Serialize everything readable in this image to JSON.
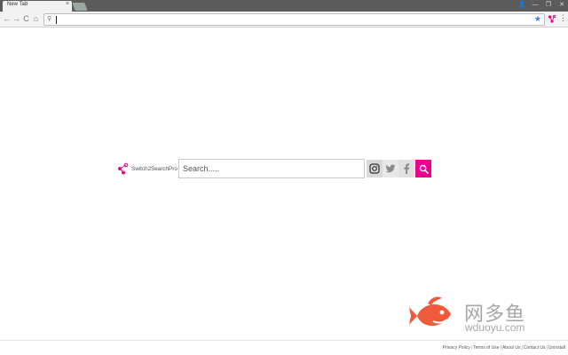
{
  "browser": {
    "tab_title": "New Tab",
    "tab_close": "×",
    "omnibox_value": "",
    "window_controls": [
      "👤",
      "—",
      "❐",
      "✕"
    ]
  },
  "nav": {
    "back": "←",
    "forward": "→",
    "reload": "C",
    "home": "⌂",
    "menu": "⋮",
    "bookmark_star": "★",
    "search_glyph": "⚲"
  },
  "brand": {
    "name": "Switch2SearchPro",
    "accent": "#ec008c"
  },
  "search": {
    "placeholder": "Search....."
  },
  "social": [
    "instagram-icon",
    "twitter-icon",
    "facebook-icon"
  ],
  "footer": {
    "links": [
      "Privacy Policy",
      "Terms of Use",
      "About Us",
      "Contact Us",
      "Uninstall"
    ]
  },
  "watermark": {
    "cn": "网多鱼",
    "en": "wduoyu.com"
  }
}
